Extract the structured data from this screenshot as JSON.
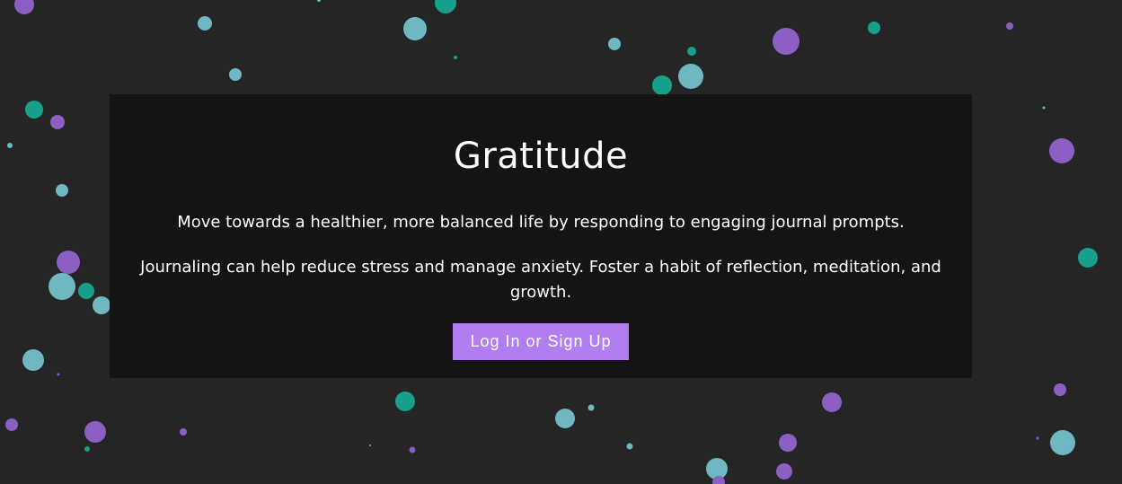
{
  "app": {
    "title": "Gratitude"
  },
  "hero": {
    "tagline": "Move towards a healthier, more balanced life by responding to engaging journal prompts.",
    "description": "Journaling can help reduce stress and manage anxiety. Foster a habit of reflection, meditation, and growth.",
    "cta_label": "Log In or Sign Up"
  },
  "colors": {
    "background": "#252525",
    "card": "#141414",
    "accent": "#b07ef0",
    "dot_purple": "#8c5fc4",
    "dot_teal": "#17a08c",
    "dot_lightblue": "#6fb8c2"
  }
}
